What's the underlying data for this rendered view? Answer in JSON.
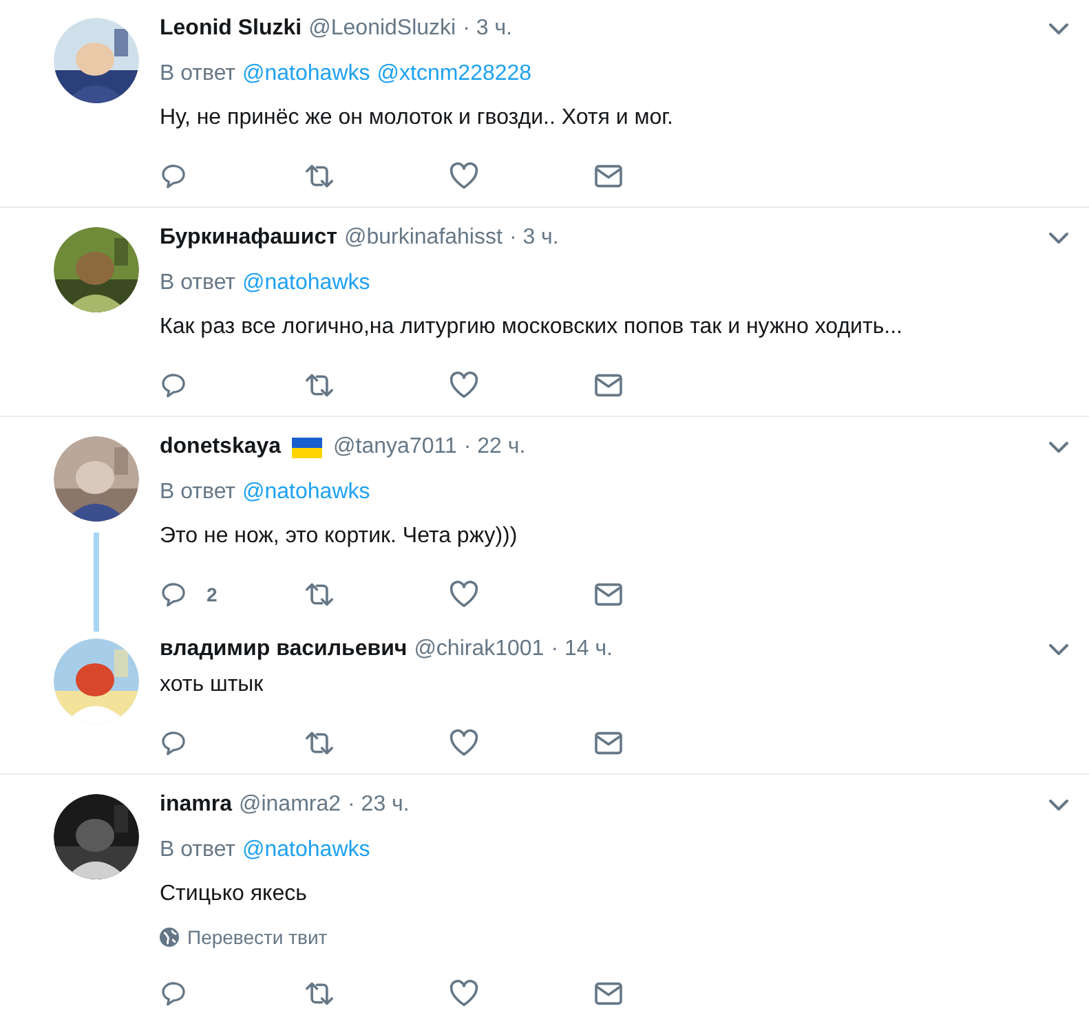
{
  "tweets": [
    {
      "name": "Leonid Sluzki",
      "handle": "@LeonidSluzki",
      "time": "· 3 ч.",
      "reply_label": "В ответ",
      "reply_to": [
        "@natohawks",
        "@xtcnm228228"
      ],
      "text": "Ну, не принёс же он молоток и гвозди.. Хотя и мог.",
      "thread_continues": false
    },
    {
      "name": "Буркинафашист",
      "handle": "@burkinafahisst",
      "time": "· 3 ч.",
      "reply_label": "В ответ",
      "reply_to": [
        "@natohawks"
      ],
      "text": "Как раз все логично,на литургию московских попов так и нужно ходить...",
      "thread_continues": false
    },
    {
      "name": "donetskaya",
      "flag_shown": true,
      "handle": "@tanya7011",
      "time": "· 22 ч.",
      "reply_label": "В ответ",
      "reply_to": [
        "@natohawks"
      ],
      "text": "Это не нож, это кортик. Чета ржу)))",
      "reply_count": "2",
      "thread_continues": true
    },
    {
      "name": "владимир васильевич",
      "handle": "@chirak1001",
      "time": "· 14 ч.",
      "text": "хоть штык",
      "thread_continues": false
    },
    {
      "name": "inamra",
      "handle": "@inamra2",
      "time": "· 23 ч.",
      "reply_label": "В ответ",
      "reply_to": [
        "@natohawks"
      ],
      "text": "Стицько якесь",
      "translate": "Перевести твит",
      "thread_continues": false
    }
  ]
}
